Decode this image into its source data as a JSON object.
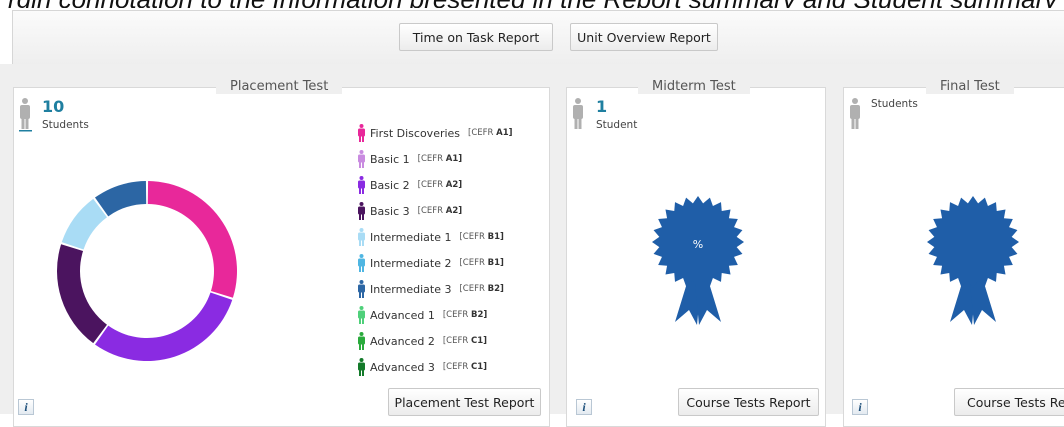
{
  "caption": "rgin connotation to the Information presented in the Report summary and Student summary section and the targe",
  "toolbar": {
    "time_on_task_label": "Time on Task Report",
    "unit_overview_label": "Unit Overview Report"
  },
  "placement_panel": {
    "title": "Placement Test",
    "student_count": "10",
    "student_label": "Students",
    "report_button_label": "Placement Test Report",
    "legend": [
      {
        "label": "First Discoveries",
        "cefr_prefix": "[CEFR",
        "cefr_level": "A1]",
        "color": "#e8289a"
      },
      {
        "label": "Basic 1",
        "cefr_prefix": "[CEFR",
        "cefr_level": "A1]",
        "color": "#c98be0"
      },
      {
        "label": "Basic 2",
        "cefr_prefix": "[CEFR",
        "cefr_level": "A2]",
        "color": "#8a2be2"
      },
      {
        "label": "Basic 3",
        "cefr_prefix": "[CEFR",
        "cefr_level": "A2]",
        "color": "#4b145f"
      },
      {
        "label": "Intermediate 1",
        "cefr_prefix": "[CEFR",
        "cefr_level": "B1]",
        "color": "#a9dcf5"
      },
      {
        "label": "Intermediate 2",
        "cefr_prefix": "[CEFR",
        "cefr_level": "B1]",
        "color": "#4fb6e2"
      },
      {
        "label": "Intermediate 3",
        "cefr_prefix": "[CEFR",
        "cefr_level": "B2]",
        "color": "#2c66a4"
      },
      {
        "label": "Advanced 1",
        "cefr_prefix": "[CEFR",
        "cefr_level": "B2]",
        "color": "#4fd07a"
      },
      {
        "label": "Advanced 2",
        "cefr_prefix": "[CEFR",
        "cefr_level": "C1]",
        "color": "#2aaa3c"
      },
      {
        "label": "Advanced 3",
        "cefr_prefix": "[CEFR",
        "cefr_level": "C1]",
        "color": "#137a2a"
      }
    ]
  },
  "midterm_panel": {
    "title": "Midterm Test",
    "student_count": "1",
    "student_label": "Student",
    "badge_text": "%",
    "report_button_label": "Course Tests Report"
  },
  "final_panel": {
    "title": "Final Test",
    "student_label": "Students",
    "report_button_label": "Course Tests Report"
  },
  "info_label": "i",
  "colors": {
    "count_blue": "#1f7fa0",
    "badge_blue": "#1f5ea8",
    "person_gray": "#b0b0b0"
  },
  "chart_data": {
    "type": "pie",
    "donut": true,
    "series": [
      {
        "name": "First Discoveries",
        "value": 3,
        "color": "#e8289a"
      },
      {
        "name": "Basic 2",
        "value": 3,
        "color": "#8a2be2"
      },
      {
        "name": "Basic 3",
        "value": 2,
        "color": "#4b145f"
      },
      {
        "name": "Intermediate 1",
        "value": 1,
        "color": "#a9dcf5"
      },
      {
        "name": "Intermediate 3",
        "value": 1,
        "color": "#2c66a4"
      }
    ]
  }
}
